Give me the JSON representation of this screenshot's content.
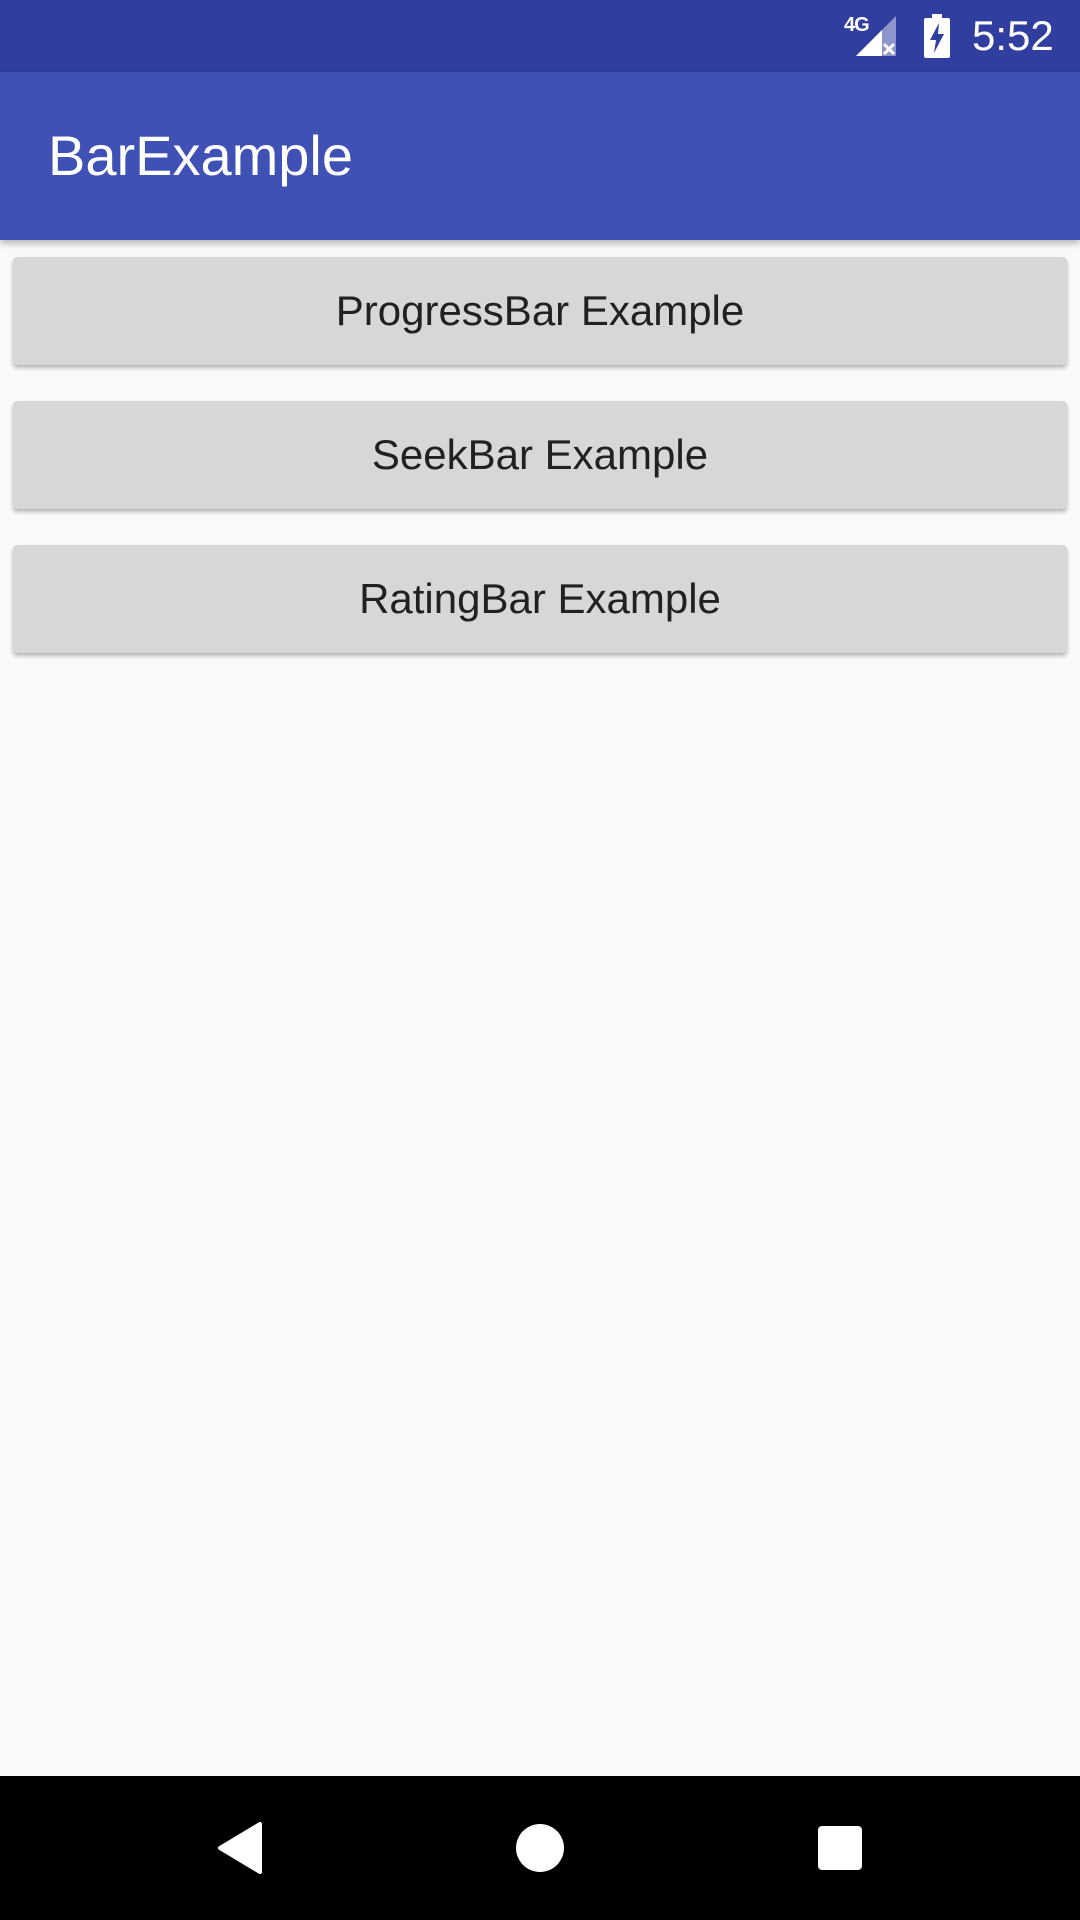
{
  "status_bar": {
    "network_type": "4G",
    "time": "5:52",
    "icons": [
      "signal-no-data-icon",
      "battery-charging-icon"
    ]
  },
  "app_bar": {
    "title": "BarExample"
  },
  "buttons": [
    {
      "label": "ProgressBar Example"
    },
    {
      "label": "SeekBar Example"
    },
    {
      "label": "RatingBar Example"
    }
  ],
  "nav_bar": {
    "icons": [
      "back-icon",
      "home-icon",
      "recents-icon"
    ]
  },
  "colors": {
    "status_bar": "#303f9f",
    "primary": "#3f51b5",
    "button_bg": "#d6d7d7",
    "background": "#fafafa"
  }
}
